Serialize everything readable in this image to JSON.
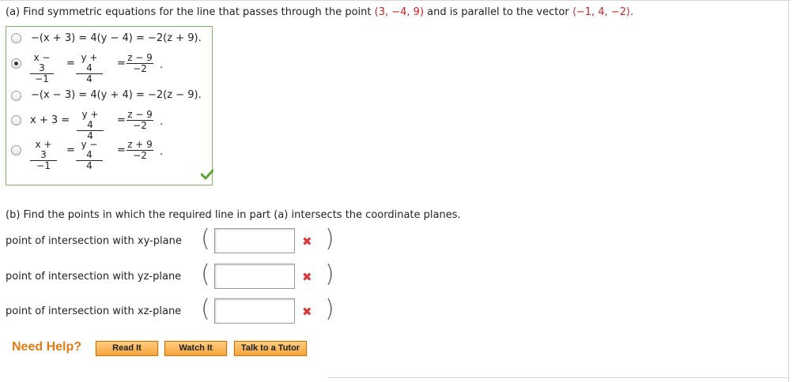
{
  "part_a": {
    "prompt": "(a) Find symmetric equations for the line that passes through the point",
    "point": "(3, −4, 9)",
    "and_text": "and is parallel to the vector",
    "vector": "⟨−1, 4, −2⟩.",
    "choices": [
      {
        "text": "−(x + 3) = 4(y − 4) = −2(z + 9).",
        "selected": false
      },
      {
        "fractions": [
          [
            "x − 3",
            "−1"
          ],
          [
            "y + 4",
            "4"
          ],
          [
            "z − 9",
            "−2"
          ]
        ],
        "selected": true
      },
      {
        "text": "−(x − 3) = 4(y + 4) = −2(z − 9).",
        "selected": false
      },
      {
        "lead": "x + 3 =",
        "fractions": [
          [
            "y + 4",
            "4"
          ],
          [
            "z − 9",
            "−2"
          ]
        ],
        "selected": false
      },
      {
        "fractions": [
          [
            "x + 3",
            "−1"
          ],
          [
            "y − 4",
            "4"
          ],
          [
            "z + 9",
            "−2"
          ]
        ],
        "selected": false
      }
    ],
    "correct_icon": "checkmark-icon"
  },
  "part_b": {
    "prompt": "(b) Find the points in which the required line in part (a) intersects the coordinate planes.",
    "rows": [
      {
        "label": "point of intersection with xy-plane",
        "value": ""
      },
      {
        "label": "point of intersection with yz-plane",
        "value": ""
      },
      {
        "label": "point of intersection with xz-plane",
        "value": ""
      }
    ],
    "incorrect_icon": "x-mark-icon"
  },
  "help": {
    "title": "Need Help?",
    "buttons": [
      "Read It",
      "Watch It",
      "Talk to a Tutor"
    ]
  },
  "colors": {
    "accent_orange": "#e07b16",
    "correct_green": "#5aa832",
    "incorrect_red": "#d63a3a",
    "math_red": "#cc2222"
  }
}
